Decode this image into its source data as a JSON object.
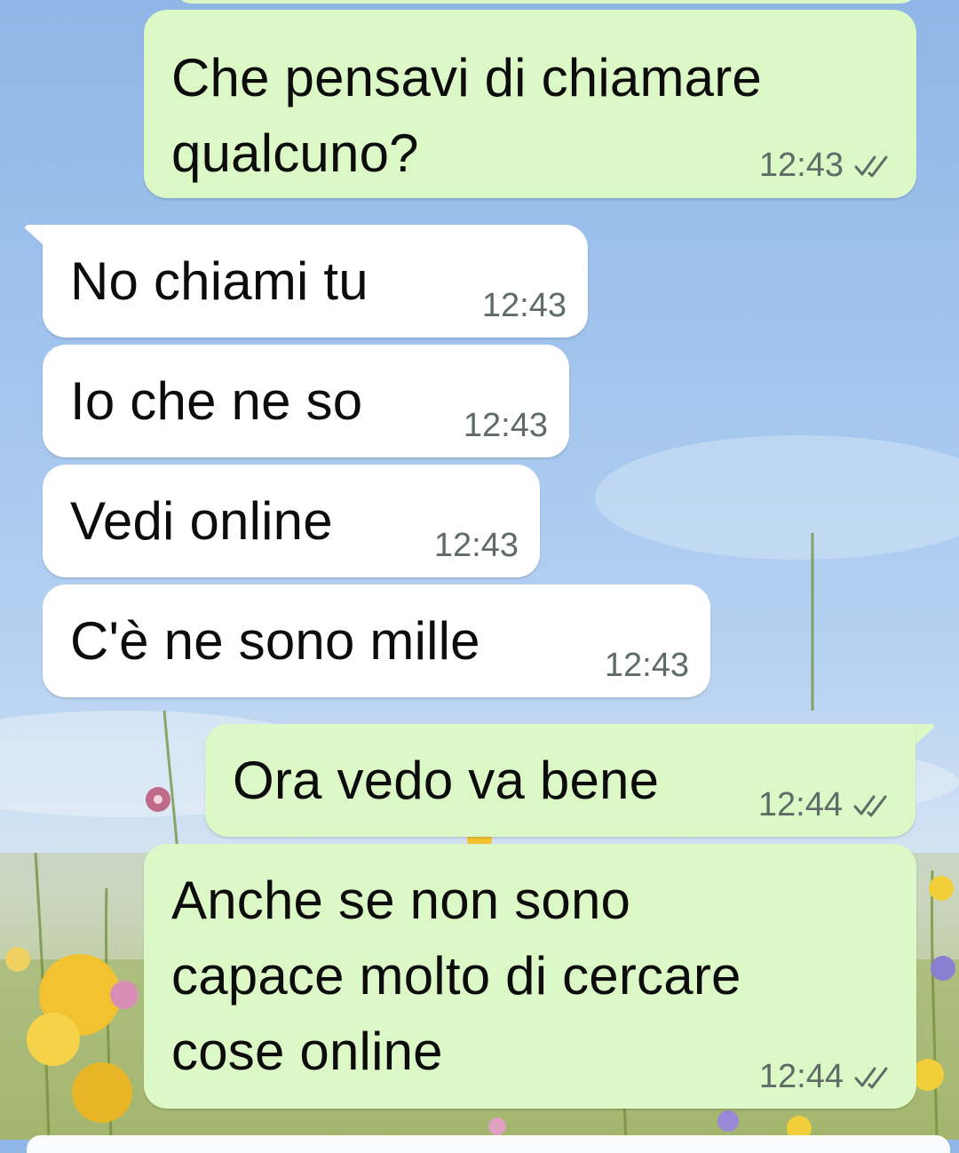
{
  "colors": {
    "outgoing_bubble": "#dcf8c6",
    "incoming_bubble": "#ffffff",
    "timestamp": "#5f6b66",
    "read_ticks": "#5f6b66"
  },
  "messages": [
    {
      "direction": "outgoing",
      "text": "Che pensavi di chiamare\nqualcuno?",
      "time": "12:43",
      "status": "double-check-icon"
    },
    {
      "direction": "incoming",
      "text": "No chiami tu",
      "time": "12:43"
    },
    {
      "direction": "incoming",
      "text": "Io che ne so",
      "time": "12:43"
    },
    {
      "direction": "incoming",
      "text": "Vedi online",
      "time": "12:43"
    },
    {
      "direction": "incoming",
      "text": "C'è ne sono mille",
      "time": "12:43"
    },
    {
      "direction": "outgoing",
      "text": "Ora vedo va bene",
      "time": "12:44",
      "status": "double-check-icon"
    },
    {
      "direction": "outgoing",
      "text": "Anche se non sono\ncapace molto di cercare\ncose online",
      "time": "12:44",
      "status": "double-check-icon"
    }
  ]
}
